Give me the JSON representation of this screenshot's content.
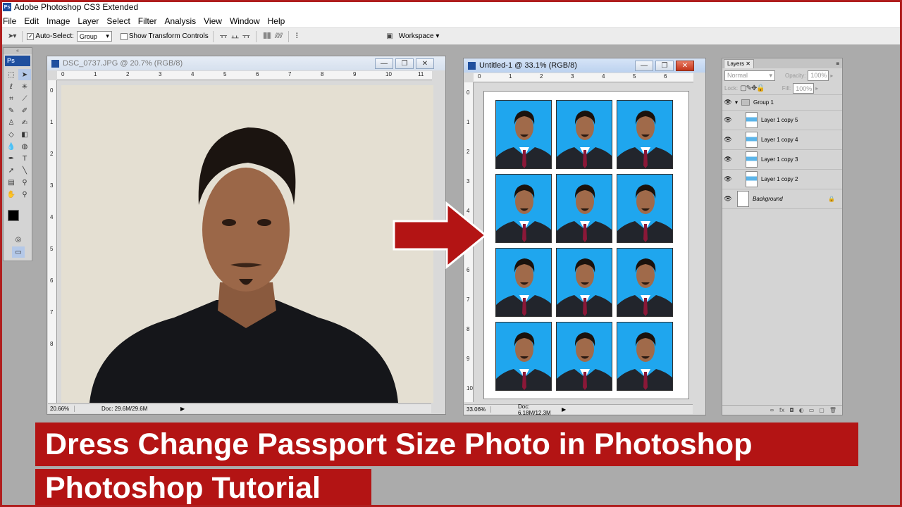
{
  "app": {
    "title": "Adobe Photoshop CS3 Extended",
    "badge": "Ps"
  },
  "menu": [
    "File",
    "Edit",
    "Image",
    "Layer",
    "Select",
    "Filter",
    "Analysis",
    "View",
    "Window",
    "Help"
  ],
  "options": {
    "auto_select_label": "Auto-Select:",
    "auto_select_checked": true,
    "auto_select_value": "Group",
    "show_transform_label": "Show Transform Controls",
    "workspace_label": "Workspace"
  },
  "tools": {
    "badge": "Ps",
    "collapse": "«"
  },
  "doc1": {
    "title": "DSC_0737.JPG @ 20.7% (RGB/8)",
    "zoom": "20.66%",
    "doc_size": "Doc: 29.6M/29.6M",
    "ruler_top": [
      "0",
      "1",
      "2",
      "3",
      "4",
      "5",
      "6",
      "7",
      "8",
      "9",
      "10",
      "11"
    ],
    "ruler_left": [
      "0",
      "1",
      "2",
      "3",
      "4",
      "5",
      "6",
      "7",
      "8"
    ]
  },
  "doc2": {
    "title": "Untitled-1 @ 33.1% (RGB/8)",
    "zoom": "33.06%",
    "doc_size": "Doc: 6.18M/12.3M",
    "ruler_top": [
      "0",
      "1",
      "2",
      "3",
      "4",
      "5",
      "6"
    ],
    "ruler_left": [
      "0",
      "1",
      "2",
      "3",
      "4",
      "5",
      "6",
      "7",
      "8",
      "9",
      "10"
    ]
  },
  "window_buttons": {
    "minimize": "—",
    "restore": "❐",
    "close": "✕"
  },
  "layers": {
    "tab": "Layers",
    "blend_mode": "Normal",
    "opacity_label": "Opacity:",
    "opacity_value": "100%",
    "lock_label": "Lock:",
    "fill_label": "Fill:",
    "fill_value": "100%",
    "items": [
      "Group 1",
      "Layer 1 copy 5",
      "Layer 1 copy 4",
      "Layer 1 copy 3",
      "Layer 1 copy 2",
      "Background"
    ]
  },
  "banner": {
    "line1": "Dress Change Passport Size Photo in Photoshop",
    "line2": "Photoshop Tutorial"
  },
  "colors": {
    "accent_red": "#b31414",
    "photo_blue": "#1fa6ee",
    "ps_blue": "#1f4f9e"
  }
}
